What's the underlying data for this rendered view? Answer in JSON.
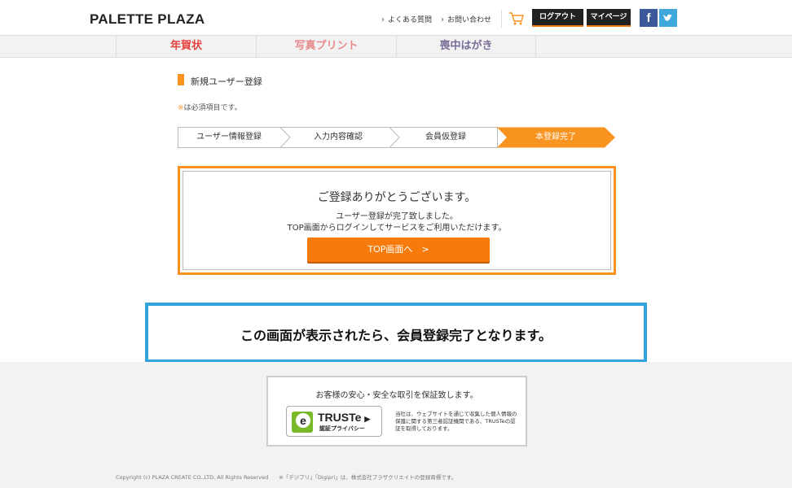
{
  "header": {
    "logo": "PALETTE PLAZA",
    "faq_link": "よくある質問",
    "contact_link": "お問い合わせ",
    "logout_button": "ログアウト",
    "mypage_button": "マイページ",
    "facebook": "f",
    "twitter": "t"
  },
  "nav": {
    "items": [
      {
        "label": "年賀状",
        "color": "#e8433f"
      },
      {
        "label": "写真プリント",
        "color": "#e8898b"
      },
      {
        "label": "喪中はがき",
        "color": "#7a6c98"
      }
    ]
  },
  "page": {
    "section_title": "新規ユーザー登録",
    "required_mark": "※",
    "required_note": "は必須項目です。"
  },
  "steps": [
    {
      "label": "ユーザー情報登録",
      "active": false
    },
    {
      "label": "入力内容確認",
      "active": false
    },
    {
      "label": "会員仮登録",
      "active": false
    },
    {
      "label": "本登録完了",
      "active": true
    }
  ],
  "completion": {
    "title": "ご登録ありがとうございます。",
    "line1": "ユーザー登録が完了致しました。",
    "line2": "TOP画面からログインしてサービスをご利用いただけます。",
    "button": "TOP画面へ　>"
  },
  "callout": {
    "text": "この画面が表示されたら、会員登録完了となります。"
  },
  "footer": {
    "trust_title": "お客様の安心・安全な取引を保証致します。",
    "truste_name": "TRUSTe",
    "truste_sub": "認証プライバシー",
    "truste_desc": "当社は、ウェブサイトを通じて収集した個人情報の保護に関する第三者認証機関である、TRUSTeの認証を取得しております。",
    "copyright": "Copyright (c) PLAZA CREATE CO.,LTD. All Rights Reserved　　※「デジプリ」「Digipri」は、株式会社プラザクリエイトの登録商標です。"
  },
  "colors": {
    "accent": "#f7931e",
    "button": "#f77b0c",
    "callout_border": "#33a3dc"
  }
}
